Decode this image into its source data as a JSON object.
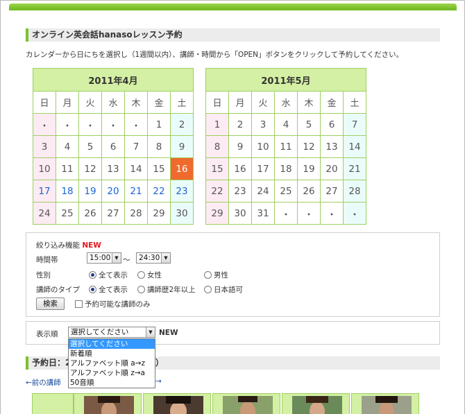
{
  "page": {
    "title": "オンライン英会話hanasoレッスン予約",
    "instructions": "カレンダーから日にちを選択し（1週間以内）、講師・時間から「OPEN」ボタンをクリックして予約してください。"
  },
  "calendars": [
    {
      "title": "2011年4月",
      "weekdays": [
        "日",
        "月",
        "火",
        "水",
        "木",
        "金",
        "土"
      ],
      "weeks": [
        [
          "・",
          "・",
          "・",
          "・",
          "・",
          "1",
          "2"
        ],
        [
          "3",
          "4",
          "5",
          "6",
          "7",
          "8",
          "9"
        ],
        [
          "10",
          "11",
          "12",
          "13",
          "14",
          "15",
          "16"
        ],
        [
          "17",
          "18",
          "19",
          "20",
          "21",
          "22",
          "23"
        ],
        [
          "24",
          "25",
          "26",
          "27",
          "28",
          "29",
          "30"
        ]
      ]
    },
    {
      "title": "2011年5月",
      "weekdays": [
        "日",
        "月",
        "火",
        "水",
        "木",
        "金",
        "土"
      ],
      "weeks": [
        [
          "1",
          "2",
          "3",
          "4",
          "5",
          "6",
          "7"
        ],
        [
          "8",
          "9",
          "10",
          "11",
          "12",
          "13",
          "14"
        ],
        [
          "15",
          "16",
          "17",
          "18",
          "19",
          "20",
          "21"
        ],
        [
          "22",
          "23",
          "24",
          "25",
          "26",
          "27",
          "28"
        ],
        [
          "29",
          "30",
          "31",
          "・",
          "・",
          "・",
          "・"
        ]
      ]
    }
  ],
  "filter": {
    "heading": "絞り込み機能",
    "new_badge": "NEW",
    "time_label": "時間帯",
    "time_from": "15:00",
    "time_sep": "〜",
    "time_to": "24:30",
    "gender_label": "性別",
    "gender_options": [
      "全て表示",
      "女性",
      "男性"
    ],
    "type_label": "講師のタイプ",
    "type_options": [
      "全て表示",
      "講師歴2年以上",
      "日本語可"
    ],
    "search_button": "検索",
    "reservable_only": "予約可能な講師のみ"
  },
  "sort": {
    "label": "表示順",
    "selected": "選択してください",
    "new_badge": "NEW",
    "options": [
      "選択してください",
      "新着順",
      "アルファベット順 a→z",
      "アルファベット順 z→a",
      "50音順"
    ]
  },
  "reservation": {
    "heading": "予約日：2",
    "heading_tail": "）",
    "prev_link": "←前の講師",
    "next_arrow": "→"
  },
  "colors": {
    "accent_green": "#7cc12e",
    "calendar_header": "#d4f0a4",
    "today": "#ef6a2c",
    "open_date": "#1a63d6",
    "new_badge": "#e8141e"
  }
}
